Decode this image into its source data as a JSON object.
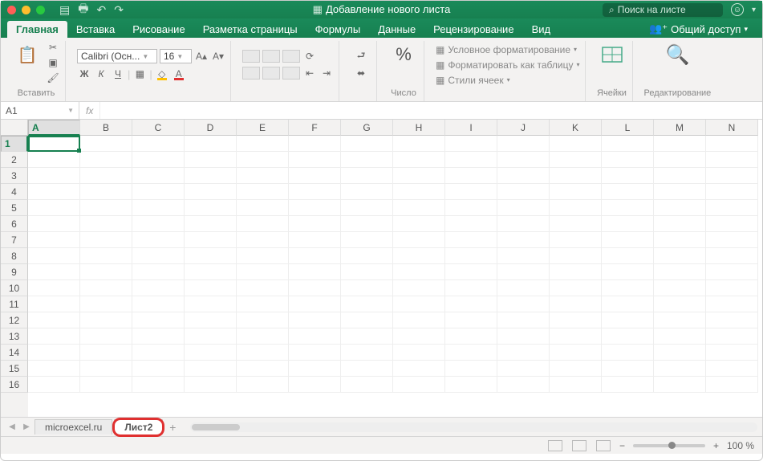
{
  "title": "Добавление нового листа",
  "search_placeholder": "Поиск на листе",
  "tabs": [
    "Главная",
    "Вставка",
    "Рисование",
    "Разметка страницы",
    "Формулы",
    "Данные",
    "Рецензирование",
    "Вид"
  ],
  "share": "Общий доступ",
  "ribbon": {
    "paste": "Вставить",
    "font_name": "Calibri (Осн...",
    "font_size": "16",
    "bold": "Ж",
    "italic": "К",
    "underline": "Ч",
    "number": "Число",
    "cond_fmt": "Условное форматирование",
    "as_table": "Форматировать как таблицу",
    "cell_styles": "Стили ячеек",
    "cells": "Ячейки",
    "editing": "Редактирование"
  },
  "namebox": "A1",
  "columns": [
    "A",
    "B",
    "C",
    "D",
    "E",
    "F",
    "G",
    "H",
    "I",
    "J",
    "K",
    "L",
    "M",
    "N"
  ],
  "rows": [
    "1",
    "2",
    "3",
    "4",
    "5",
    "6",
    "7",
    "8",
    "9",
    "10",
    "11",
    "12",
    "13",
    "14",
    "15",
    "16"
  ],
  "sheets": {
    "s1": "microexcel.ru",
    "s2": "Лист2"
  },
  "zoom": "100 %"
}
